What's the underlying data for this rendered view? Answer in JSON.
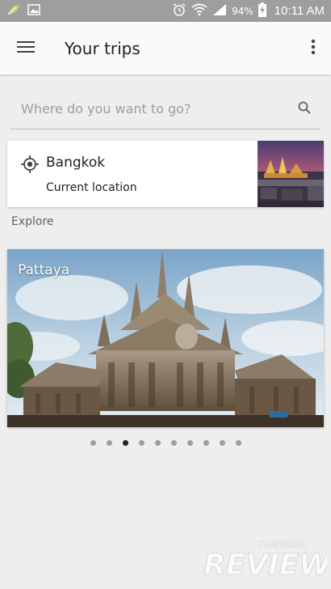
{
  "status_bar": {
    "battery": "94%",
    "time": "10:11 AM"
  },
  "app_bar": {
    "title": "Your trips"
  },
  "search": {
    "placeholder": "Where do you want to go?"
  },
  "location_card": {
    "city": "Bangkok",
    "subtitle": "Current location"
  },
  "explore": {
    "label": "Explore",
    "cards": [
      {
        "city": "Pattaya"
      }
    ],
    "pager": {
      "count": 10,
      "active_index": 2
    }
  },
  "watermark": {
    "brand_top": "THAIWARE",
    "brand_main": "REVIEW"
  },
  "colors": {
    "status_bar": "#9e9e9e",
    "app_bar": "#fafafa",
    "background": "#eeeeee",
    "dot": "#9e9e9e",
    "dot_active": "#212121"
  }
}
